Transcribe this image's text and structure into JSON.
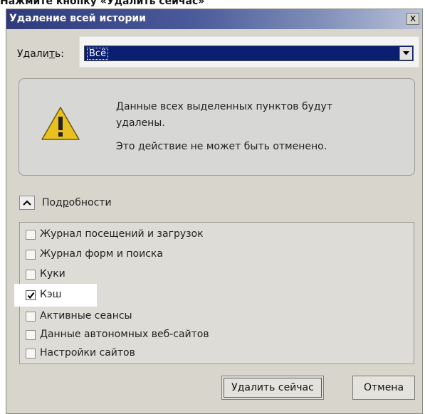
{
  "caption": "Нажмите кнопку «Удалить сейчас»",
  "dialog": {
    "title": "Удаление всей истории",
    "close_label": "x"
  },
  "time_range": {
    "label_before": "Удали",
    "label_accel": "т",
    "label_after": "ь:",
    "selected": "Всё"
  },
  "warning": {
    "line1": "Данные всех выделенных пунктов будут",
    "line2": "удалены.",
    "line3": "Это действие не может быть отменено."
  },
  "details": {
    "label_before": "Под",
    "label_accel": "р",
    "label_after": "обности"
  },
  "items": [
    {
      "label": "Журнал посещений и загрузок",
      "checked": false
    },
    {
      "label": "Журнал форм и поиска",
      "checked": false
    },
    {
      "label": "Куки",
      "checked": false
    },
    {
      "label": "Кэш",
      "checked": true
    },
    {
      "label": "Активные сеансы",
      "checked": false
    },
    {
      "label": "Данные автономных веб-сайтов",
      "checked": false
    },
    {
      "label": "Настройки сайтов",
      "checked": false
    }
  ],
  "buttons": {
    "delete_now": "Удалить сейчас",
    "cancel": "Отмена"
  }
}
